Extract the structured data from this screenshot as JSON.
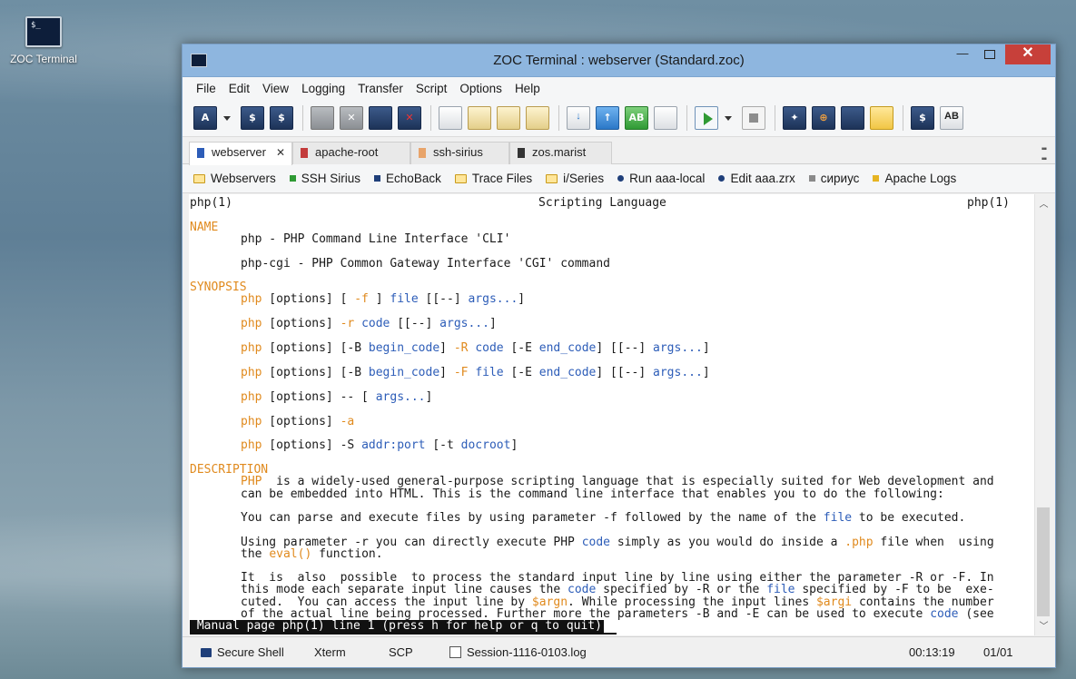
{
  "desktop": {
    "icon_label": "ZOC Terminal",
    "icon_glyph": "$_"
  },
  "window": {
    "title": "ZOC Terminal : webserver (Standard.zoc)",
    "controls": {
      "minimize": "—",
      "close": "✕"
    }
  },
  "menu": [
    "File",
    "Edit",
    "View",
    "Logging",
    "Transfer",
    "Script",
    "Options",
    "Help"
  ],
  "toolbar_icons": [
    "address-book-icon",
    "quick-connect-icon",
    "disconnect-icon",
    "copy-session-icon",
    "cancel-icon",
    "new-session-icon",
    "close-session-icon",
    "copy-icon",
    "paste-icon",
    "paste-edit-icon",
    "print-icon",
    "download-icon",
    "upload-icon",
    "translate-icon",
    "keyboard-icon",
    "run-script-icon",
    "stop-script-icon",
    "host-directory-icon",
    "compass-icon",
    "terminal-icon",
    "folder-icon",
    "options-icon",
    "font-icon"
  ],
  "tabs": [
    {
      "label": "webserver",
      "active": true,
      "close": "✕",
      "color": "#2d5db8"
    },
    {
      "label": "apache-root",
      "active": false,
      "color": "#c33b3b"
    },
    {
      "label": "ssh-sirius",
      "active": false,
      "color": "#e8a46a"
    },
    {
      "label": "zos.marist",
      "active": false,
      "color": "#333333"
    }
  ],
  "bookmarks": [
    {
      "label": "Webservers",
      "icon": "folder"
    },
    {
      "label": "SSH Sirius",
      "icon": "square",
      "color": "#2f9a34"
    },
    {
      "label": "EchoBack",
      "icon": "square",
      "color": "#1f3f7a"
    },
    {
      "label": "Trace Files",
      "icon": "folder"
    },
    {
      "label": "i/Series",
      "icon": "folder"
    },
    {
      "label": "Run aaa-local",
      "icon": "dot"
    },
    {
      "label": "Edit aaa.zrx",
      "icon": "dot"
    },
    {
      "label": "сириус",
      "icon": "square",
      "color": "#8a8a8a"
    },
    {
      "label": "Apache Logs",
      "icon": "square",
      "color": "#e6b422"
    }
  ],
  "terminal": {
    "header_left": "php(1)",
    "header_center": "Scripting Language",
    "header_right": "php(1)",
    "name_heading": "NAME",
    "name_line1": "php - PHP Command Line Interface 'CLI'",
    "name_line2": "php-cgi - PHP Common Gateway Interface 'CGI' command",
    "synopsis_heading": "SYNOPSIS",
    "desc_heading": "DESCRIPTION",
    "desc_p1a_php": "PHP",
    "desc_p1a_rest": "  is a widely-used general-purpose scripting language that is especially suited for Web development and",
    "desc_p1b": "can be embedded into HTML. This is the command line interface that enables you to do the following:",
    "desc_p2_a": "You can parse and execute files by using parameter -f followed by the name of the ",
    "desc_p2_file": "file",
    "desc_p2_b": " to be executed.",
    "desc_p3a_a": "Using parameter -r you can directly execute PHP ",
    "desc_p3a_code": "code",
    "desc_p3a_b": " simply as you would do inside a ",
    "desc_p3a_php": ".php",
    "desc_p3a_c": " file when  using",
    "desc_p3b_a": "the ",
    "desc_p3b_eval": "eval()",
    "desc_p3b_b": " function.",
    "desc_p4a": "It  is  also  possible  to process the standard input line by line using either the parameter -R or -F. In",
    "desc_p4b_a": "this mode each separate input line causes the ",
    "desc_p4b_code": "code",
    "desc_p4b_b": " specified by -R or the ",
    "desc_p4b_file": "file",
    "desc_p4b_c": " specified by -F to be  exe‐",
    "desc_p4c_a": "cuted.  You can access the input line by ",
    "desc_p4c_argn": "$argn",
    "desc_p4c_b": ". While processing the input lines ",
    "desc_p4c_argi": "$argi",
    "desc_p4c_c": " contains the number",
    "desc_p4d_a": "of the actual line being processed. Further more the parameters -B and -E can be used to execute ",
    "desc_p4d_code": "code",
    "desc_p4d_b": " (see",
    "statusline": " Manual page php(1) line 1 (press h for help or q to quit)"
  },
  "statusbar": {
    "ssh": "Secure Shell",
    "emulation": "Xterm",
    "transfer": "SCP",
    "logfile": "Session-1116-0103.log",
    "time": "00:13:19",
    "page": "01/01"
  }
}
